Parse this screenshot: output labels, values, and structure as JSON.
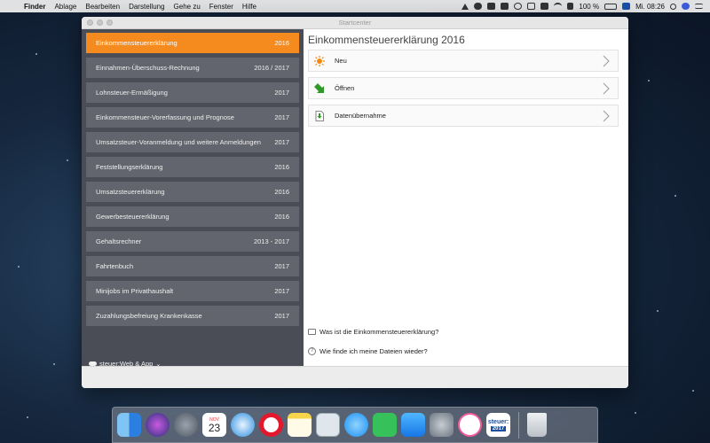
{
  "menubar": {
    "apple": "",
    "items": [
      "Finder",
      "Ablage",
      "Bearbeiten",
      "Darstellung",
      "Gehe zu",
      "Fenster",
      "Hilfe"
    ],
    "battery": "100 %",
    "clock": "Mi. 08:26"
  },
  "window": {
    "title": "Startcenter"
  },
  "sidebar": {
    "items": [
      {
        "label": "Einkommensteuererklärung",
        "year": "2016"
      },
      {
        "label": "Einnahmen-Überschuss-Rechnung",
        "year": "2016 / 2017"
      },
      {
        "label": "Lohnsteuer-Ermäßigung",
        "year": "2017"
      },
      {
        "label": "Einkommensteuer-Vorerfassung und Prognose",
        "year": "2017"
      },
      {
        "label": "Umsatzsteuer-Voranmeldung und weitere Anmeldungen",
        "year": "2017"
      },
      {
        "label": "Feststellungserklärung",
        "year": "2016"
      },
      {
        "label": "Umsatzsteuererklärung",
        "year": "2016"
      },
      {
        "label": "Gewerbesteuererklärung",
        "year": "2016"
      },
      {
        "label": "Gehaltsrechner",
        "year": "2013 - 2017"
      },
      {
        "label": "Fahrtenbuch",
        "year": "2017"
      },
      {
        "label": "Minijobs im Privathaushalt",
        "year": "2017"
      },
      {
        "label": "Zuzahlungsbefreiung Krankenkasse",
        "year": "2017"
      }
    ],
    "cloud_link": "steuer:Web & App"
  },
  "main": {
    "title": "Einkommensteuererklärung 2016",
    "actions": [
      {
        "label": "Neu",
        "icon": "sun-icon"
      },
      {
        "label": "Öffnen",
        "icon": "arrow-down-right-icon"
      },
      {
        "label": "Datenübernahme",
        "icon": "document-download-icon"
      }
    ],
    "help_links": [
      "Was ist die Einkommensteuererklärung?",
      "Wie finde ich meine Dateien wieder?"
    ]
  },
  "dock": {
    "apps": [
      "finder-icon",
      "siri-icon",
      "launchpad-icon",
      "calendar-icon",
      "safari-icon",
      "opera-icon",
      "notes-icon",
      "preview-icon",
      "messages-icon",
      "facetime-icon",
      "appstore-icon",
      "system-preferences-icon",
      "itunes-icon",
      "steuer-icon",
      "trash-icon"
    ],
    "calendar_month": "NOV",
    "calendar_day": "23",
    "steuer_label": "steuer:",
    "steuer_year": "2017"
  },
  "colors": {
    "accent": "#f58a1f",
    "sidebar_bg": "#4a4d56",
    "sidebar_item": "#62656d"
  }
}
